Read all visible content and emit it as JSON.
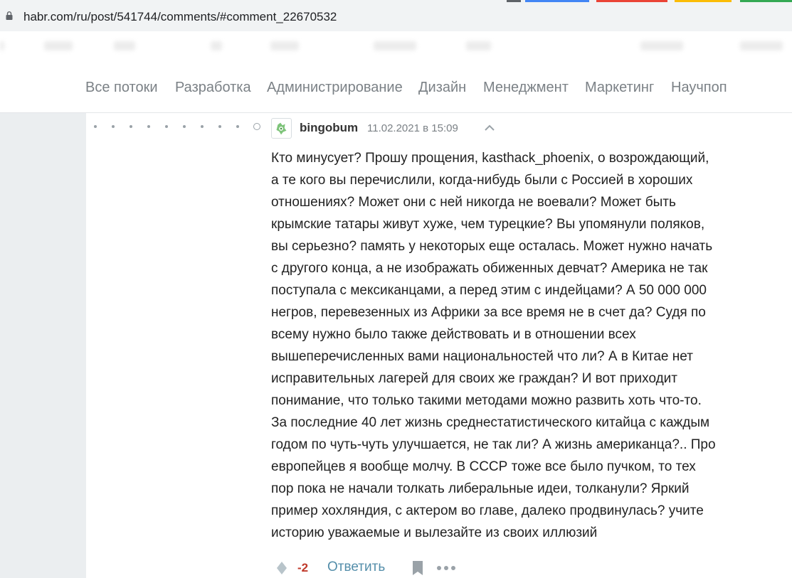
{
  "browser": {
    "url": "habr.com/ru/post/541744/comments/#comment_22670532"
  },
  "nav": {
    "items": [
      "Все потоки",
      "Разработка",
      "Администрирование",
      "Дизайн",
      "Менеджмент",
      "Маркетинг",
      "Научпоп"
    ]
  },
  "comment": {
    "author": "bingobum",
    "timestamp": "11.02.2021 в 15:09",
    "lines": [
      "Кто минусует? Прошу прощения, kasthack_phoenix, о возрождающий,",
      "а те кого вы перечислили, когда-нибудь были с Россией в хороших",
      "отношениях? Может они с ней никогда не воевали? Может быть",
      "крымские татары живут хуже, чем турецкие? Вы упомянули поляков,",
      "вы серьезно? память у некоторых еще осталась. Может нужно начать",
      "с другого конца, а не изображать обиженных девчат? Америка не так",
      "поступала с мексиканцами, а перед этим с индейцами? А 50 000 000",
      "негров, перевезенных из Африки за все время не в счет да? Судя по",
      "всему нужно было также действовать и в отношении всех",
      "вышеперечисленных вами национальностей что ли? А в Китае нет",
      "исправительных лагерей для своих же граждан? И вот приходит",
      "понимание, что только такими методами можно развить хоть что-то.",
      "За последние 40 лет жизнь среднестатистического китайца с каждым",
      "годом по чуть-чуть улучшается, не так ли? А жизнь американца?.. Про",
      "европейцев я вообще молчу. В СССР тоже все было пучком, то тех",
      "пор пока не начали толкать либеральные идеи, толканули? Яркий",
      "пример хохляндия, с актером во главе, далеко продвинулась? учите",
      "историю уважаемые и вылезайте из своих иллюзий"
    ],
    "score": "-2",
    "reply_label": "Ответить"
  },
  "colors": {
    "accent_link": "#548eaa",
    "negative_score": "#c03a2b",
    "nav_text": "#7b8186",
    "page_background": "#ebeef0"
  },
  "icons": [
    "lock-icon",
    "avatar-icon",
    "chevron-up-icon",
    "vote-icon",
    "bookmark-icon",
    "more-icon"
  ]
}
